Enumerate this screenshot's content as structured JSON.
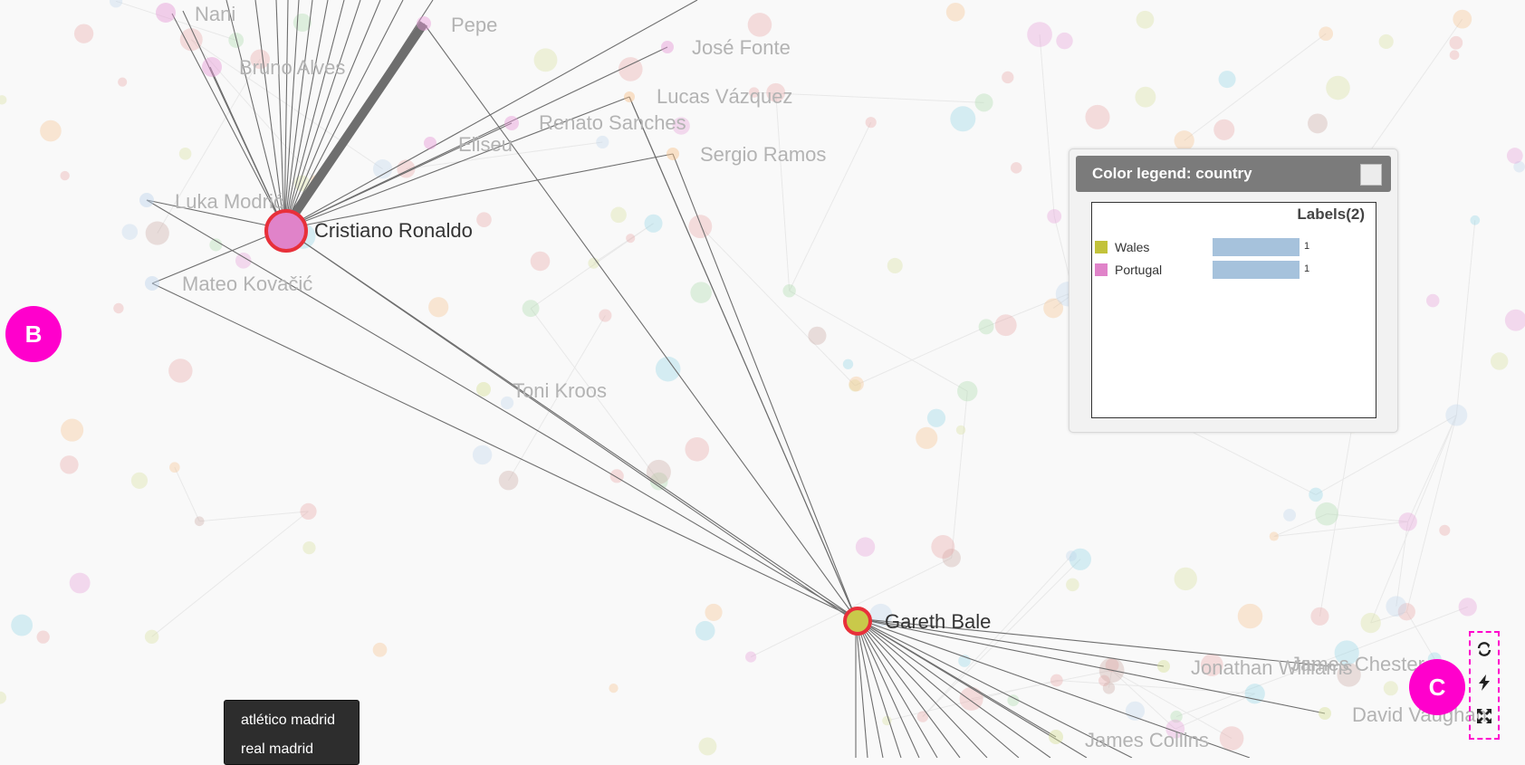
{
  "graph": {
    "focus_nodes": [
      {
        "label": "Cristiano Ronaldo",
        "color": "#e083c9"
      },
      {
        "label": "Gareth Bale",
        "color": "#c9c94a"
      }
    ],
    "faded_labels": [
      "Nani",
      "Pepe",
      "José Fonte",
      "Bruno Alves",
      "Lucas Vázquez",
      "Renato Sanches",
      "Eliseu",
      "Sergio Ramos",
      "Luka Modrić",
      "Mateo Kovačić",
      "Toni Kroos",
      "Jonathan Williams",
      "James Chester",
      "David Vaughan",
      "James Collins"
    ],
    "highlight_color": "#e8303a"
  },
  "markers": {
    "b": "B",
    "c": "C"
  },
  "legend": {
    "title": "Color legend: country",
    "count_label": "Labels(2)",
    "items": [
      {
        "label": "Wales",
        "color": "#c2c23a",
        "value": "1"
      },
      {
        "label": "Portugal",
        "color": "#e083c9",
        "value": "1"
      }
    ]
  },
  "toolbar": {
    "icons": [
      "refresh-icon",
      "bolt-icon",
      "fullscreen-icon"
    ]
  },
  "dropdown": {
    "items": [
      "atlético madrid",
      "real madrid"
    ]
  }
}
